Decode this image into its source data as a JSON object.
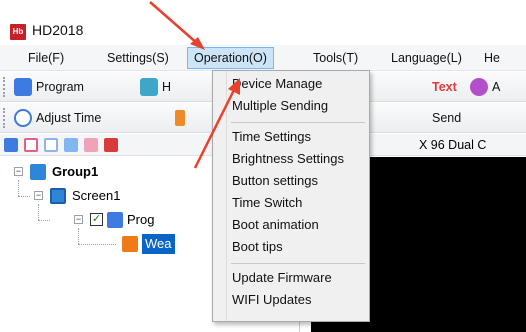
{
  "window": {
    "title": "HD2018",
    "logo_text": "Hb"
  },
  "menubar": {
    "items": [
      "File(F)",
      "Settings(S)",
      "Operation(O)",
      "Tools(T)",
      "Language(L)",
      "He"
    ]
  },
  "toolbar1": {
    "items": [
      {
        "label": "Program",
        "icon": "program-icon",
        "color": "#3d7be0"
      },
      {
        "label": "H",
        "icon": "image-icon",
        "color": "#3ea7c9"
      },
      {
        "label": "Text",
        "icon": "text-icon",
        "color": "#e33a3a"
      },
      {
        "label": "A",
        "icon": "animation-icon",
        "color": "#b34fc9"
      }
    ]
  },
  "toolbar2": {
    "items": [
      {
        "label": "Adjust Time",
        "icon": "clock-icon",
        "color": "#3d7be0"
      },
      {
        "label": "Send",
        "icon": "send-icon",
        "color": "#ef8a2a"
      }
    ]
  },
  "right_panel": {
    "header_text": "X 96  Dual C"
  },
  "tree": {
    "group": "Group1",
    "screen": "Screen1",
    "program": "Prog",
    "item": "Wea"
  },
  "dropdown": {
    "menu_title": "Operation(O)",
    "items": [
      "Device Manage",
      "Multiple Sending",
      "Time Settings",
      "Brightness Settings",
      "Button settings",
      "Time Switch",
      "Boot animation",
      "Boot tips",
      "Update Firmware",
      "WIFI Updates"
    ]
  },
  "colors": {
    "annotation_arrow": "#e8412c",
    "menu_highlight": "#cce4f7",
    "selected_node": "#0a64c8"
  }
}
